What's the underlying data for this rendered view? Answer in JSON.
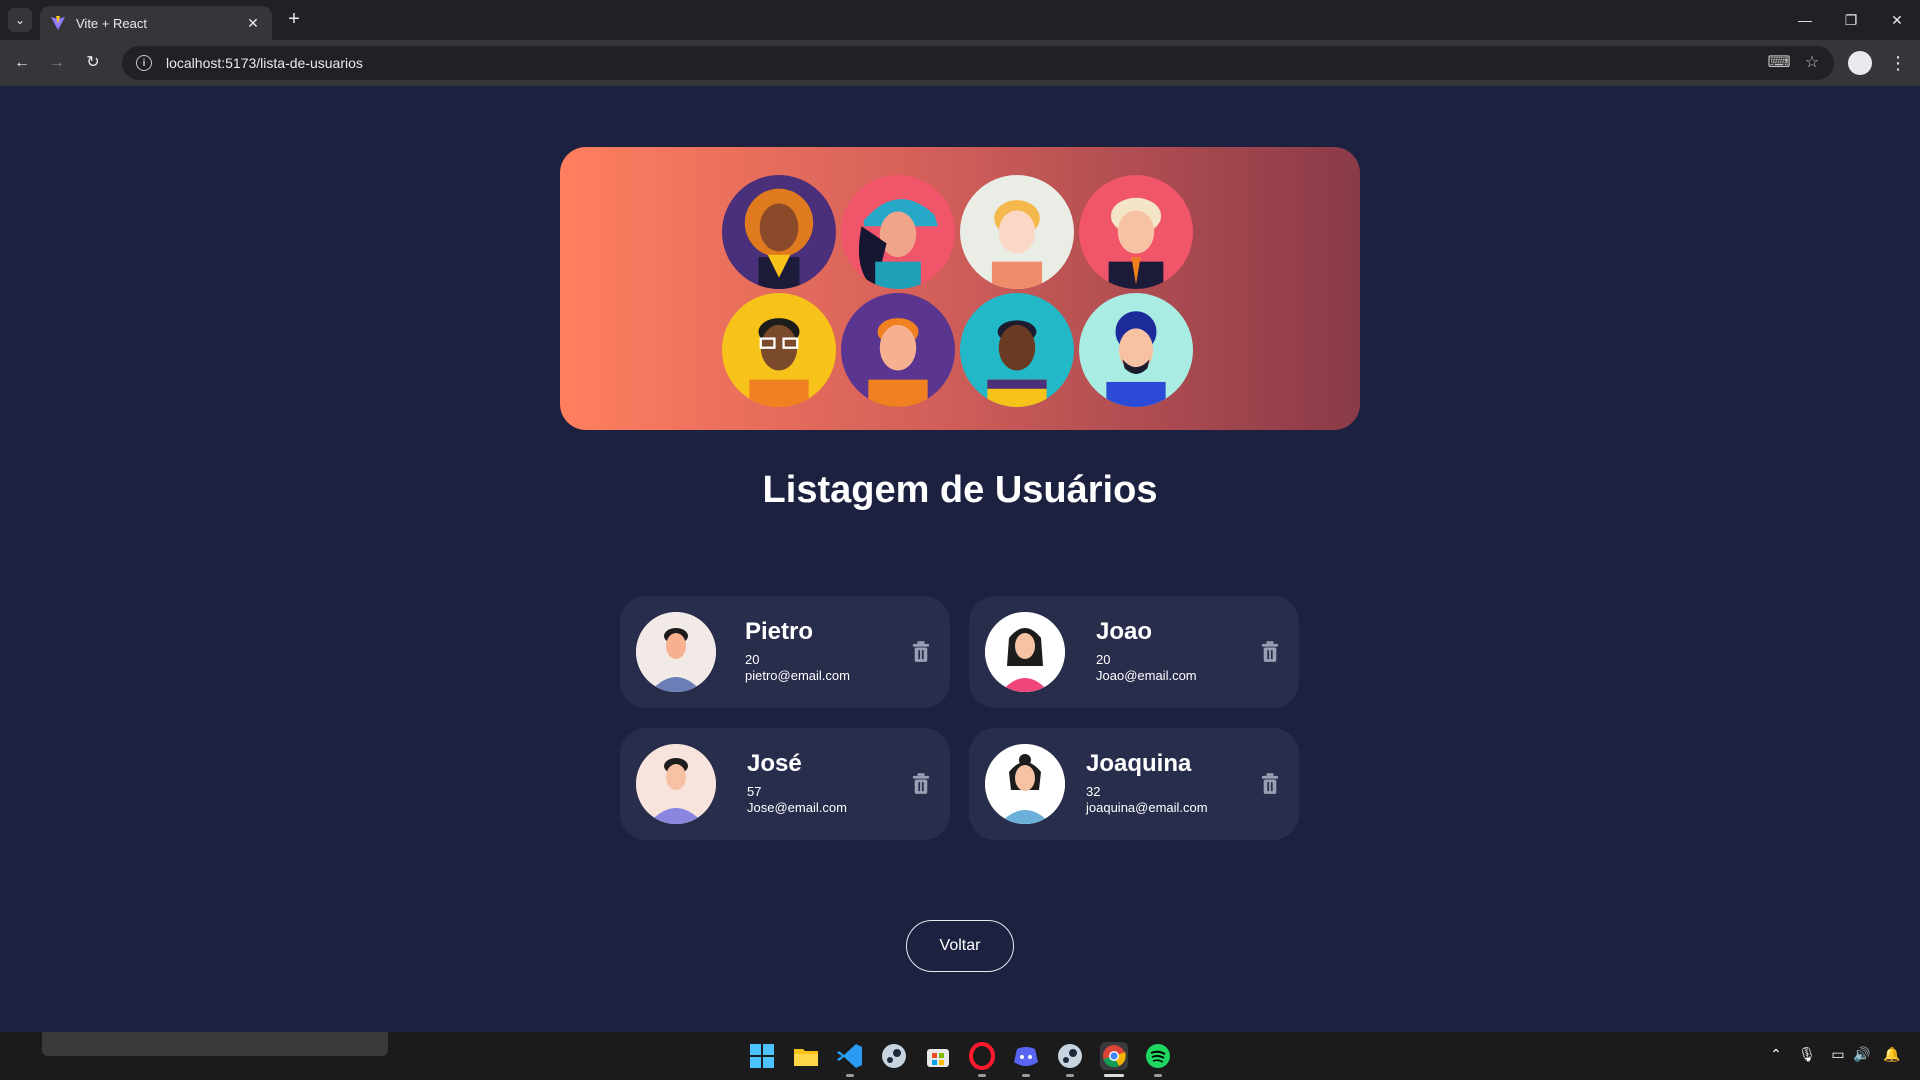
{
  "browser": {
    "tab_title": "Vite + React",
    "tab_close": "✕",
    "new_tab": "+",
    "url": "localhost:5173/lista-de-usuarios",
    "window_controls": [
      "—",
      "❐",
      "✕"
    ],
    "icons": [
      "tab-list-icon",
      "vite-favicon-icon",
      "back-icon",
      "forward-icon",
      "reload-icon",
      "site-info-icon",
      "translate-icon",
      "bookmark-star-icon",
      "profile-icon",
      "menu-icon"
    ]
  },
  "page": {
    "title": "Listagem de Usuários",
    "back_label": "Voltar",
    "users": [
      {
        "name": "Pietro",
        "age": "20",
        "email": "pietro@email.com"
      },
      {
        "name": "Joao",
        "age": "20",
        "email": "Joao@email.com"
      },
      {
        "name": "José",
        "age": "57",
        "email": "Jose@email.com"
      },
      {
        "name": "Joaquina",
        "age": "32",
        "email": "joaquina@email.com"
      }
    ],
    "colors": {
      "background": "#1c2140",
      "card": "#282d4c",
      "banner_start": "#ff7f5f",
      "banner_end": "#8a3a48"
    }
  },
  "taskbar": {
    "icons": [
      "windows-start-icon",
      "file-explorer-icon",
      "vscode-icon",
      "steam-icon",
      "microsoft-store-icon",
      "opera-icon",
      "discord-icon",
      "steam-icon-2",
      "chrome-icon",
      "spotify-icon"
    ],
    "tray_icons": [
      "chevron-up-icon",
      "microphone-icon",
      "network-icon",
      "volume-icon",
      "notification-bell-icon"
    ]
  }
}
